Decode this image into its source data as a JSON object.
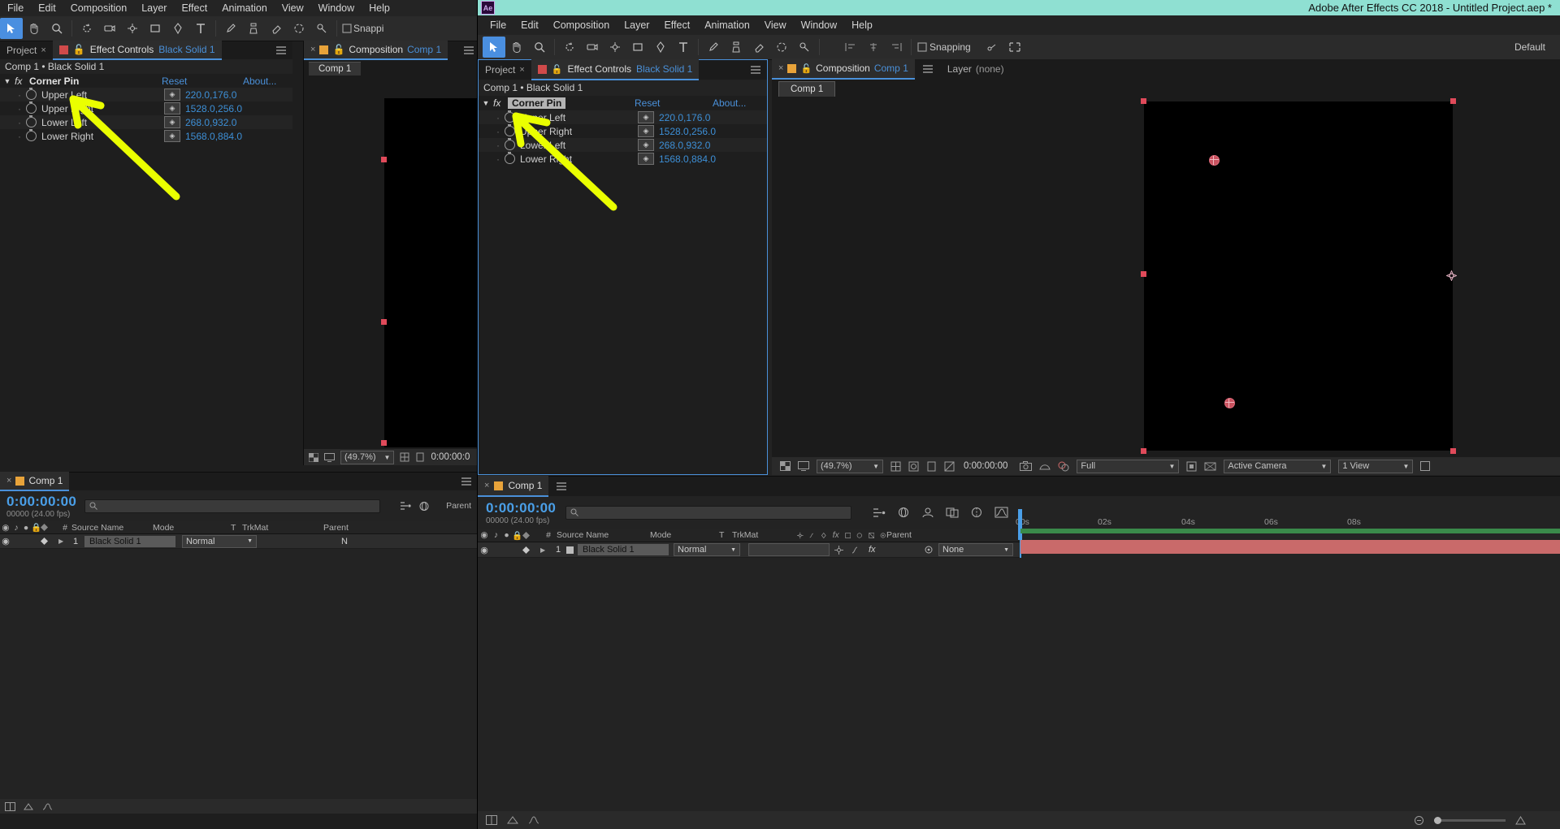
{
  "background_window": {
    "menubar": [
      "File",
      "Edit",
      "Composition",
      "Layer",
      "Effect",
      "Animation",
      "View",
      "Window",
      "Help"
    ],
    "toolbar": {
      "snapping_label": "Snappi"
    },
    "left_panel": {
      "tabs": [
        {
          "label": "Project",
          "closeable": true
        },
        {
          "label": "Effect Controls",
          "doc": "Black Solid 1"
        }
      ],
      "breadcrumb": "Comp 1 • Black Solid 1",
      "effect": {
        "name": "Corner Pin",
        "reset_label": "Reset",
        "about_label": "About...",
        "properties": [
          {
            "label": "Upper Left",
            "value": "220.0,176.0"
          },
          {
            "label": "Upper Right",
            "value": "1528.0,256.0"
          },
          {
            "label": "Lower Left",
            "value": "268.0,932.0"
          },
          {
            "label": "Lower Right",
            "value": "1568.0,884.0"
          }
        ]
      }
    },
    "comp_panel": {
      "tabs": [
        {
          "label": "Composition",
          "doc": "Comp 1"
        }
      ],
      "viewer_tab": "Comp 1",
      "zoom": "(49.7%)",
      "timecode": "0:00:00:0"
    },
    "timeline": {
      "tab": "Comp 1",
      "timecode": "0:00:00:00",
      "frames": "00000 (24.00 fps)",
      "search_placeholder": "",
      "columns": [
        "#",
        "Source Name",
        "Mode",
        "T",
        "TrkMat",
        "Parent"
      ],
      "layers": [
        {
          "index": "1",
          "name": "Black Solid 1",
          "mode": "Normal",
          "trkmat": "",
          "parent": "N"
        }
      ]
    }
  },
  "ae_window": {
    "title": "Adobe After Effects CC 2018 - Untitled Project.aep *",
    "app_icon_label": "Ae",
    "menubar": [
      "File",
      "Edit",
      "Composition",
      "Layer",
      "Effect",
      "Animation",
      "View",
      "Window",
      "Help"
    ],
    "toolbar": {
      "snapping_label": "Snapping",
      "workspace_label": "Default"
    },
    "effect_controls": {
      "tabs": [
        {
          "label": "Project",
          "closeable": true
        },
        {
          "label": "Effect Controls",
          "doc": "Black Solid 1"
        }
      ],
      "breadcrumb": "Comp 1 • Black Solid 1",
      "effect": {
        "name": "Corner Pin",
        "reset_label": "Reset",
        "about_label": "About...",
        "properties": [
          {
            "label": "Upper Left",
            "value": "220.0,176.0"
          },
          {
            "label": "Upper Right",
            "value": "1528.0,256.0"
          },
          {
            "label": "Lower Left",
            "value": "268.0,932.0"
          },
          {
            "label": "Lower Right",
            "value": "1568.0,884.0"
          }
        ]
      }
    },
    "composition_panel": {
      "tabs": [
        {
          "label": "Composition",
          "doc": "Comp 1"
        },
        {
          "label": "Layer",
          "doc": "(none)"
        }
      ],
      "viewer_tab": "Comp 1",
      "zoom": "(49.7%)",
      "timecode": "0:00:00:00",
      "resolution": "Full",
      "camera": "Active Camera",
      "views": "1 View"
    },
    "timeline_panel": {
      "tab": "Comp 1",
      "timecode": "0:00:00:00",
      "frames": "00000 (24.00 fps)",
      "search_placeholder": "",
      "columns": [
        "#",
        "Source Name",
        "Mode",
        "T",
        "TrkMat",
        "Parent"
      ],
      "layers": [
        {
          "index": "1",
          "name": "Black Solid 1",
          "mode": "Normal",
          "trkmat": "",
          "parent": "None"
        }
      ],
      "ruler_ticks": [
        "00s",
        "02s",
        "04s",
        "06s",
        "08s"
      ]
    }
  },
  "colors": {
    "title_bar": "#8fe0d2",
    "accent_blue": "#4a90d9",
    "value_blue": "#3d8fd6",
    "highlight_yellow": "#eaff00",
    "handle_red": "#e04a5a",
    "timeline_bar": "#c96a6a"
  },
  "annotations": {
    "arrow_1": "yellow-arrow-pointing-to-corner-pin-left",
    "arrow_2": "yellow-arrow-pointing-to-corner-pin-right"
  }
}
